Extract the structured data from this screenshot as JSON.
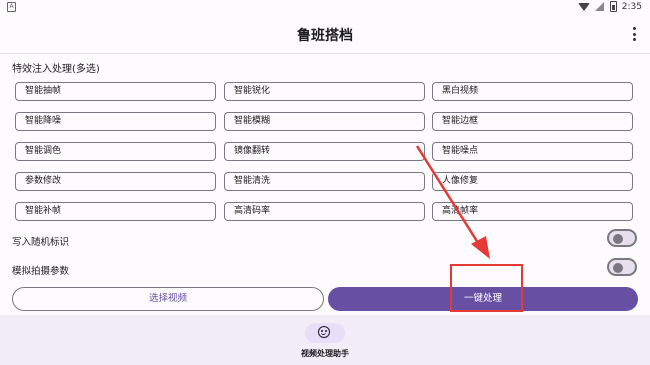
{
  "status_bar": {
    "app_icon_text": "A",
    "time": "2:35"
  },
  "app_bar": {
    "title": "鲁班搭档",
    "more_icon": "more-vert-icon"
  },
  "effects_section": {
    "title": "特效注入处理(多选)",
    "options": [
      [
        "智能抽帧",
        "智能锐化",
        "黑白视频"
      ],
      [
        "智能降噪",
        "智能模糊",
        "智能边框"
      ],
      [
        "智能调色",
        "镜像翻转",
        "智能噪点"
      ],
      [
        "参数修改",
        "智能清洗",
        "人像修复"
      ],
      [
        "智能补帧",
        "高清码率",
        "高清帧率"
      ]
    ]
  },
  "toggles": [
    {
      "label": "写入随机标识",
      "on": false
    },
    {
      "label": "模拟拍摄参数",
      "on": false
    }
  ],
  "actions": {
    "select_video": "选择视频",
    "one_click_process": "一键处理"
  },
  "bottom_nav": {
    "label": "视频处理助手",
    "icon": "face-icon"
  },
  "colors": {
    "primary": "#6750a4",
    "annotation": "#e53935",
    "background": "#fdfbfd"
  }
}
